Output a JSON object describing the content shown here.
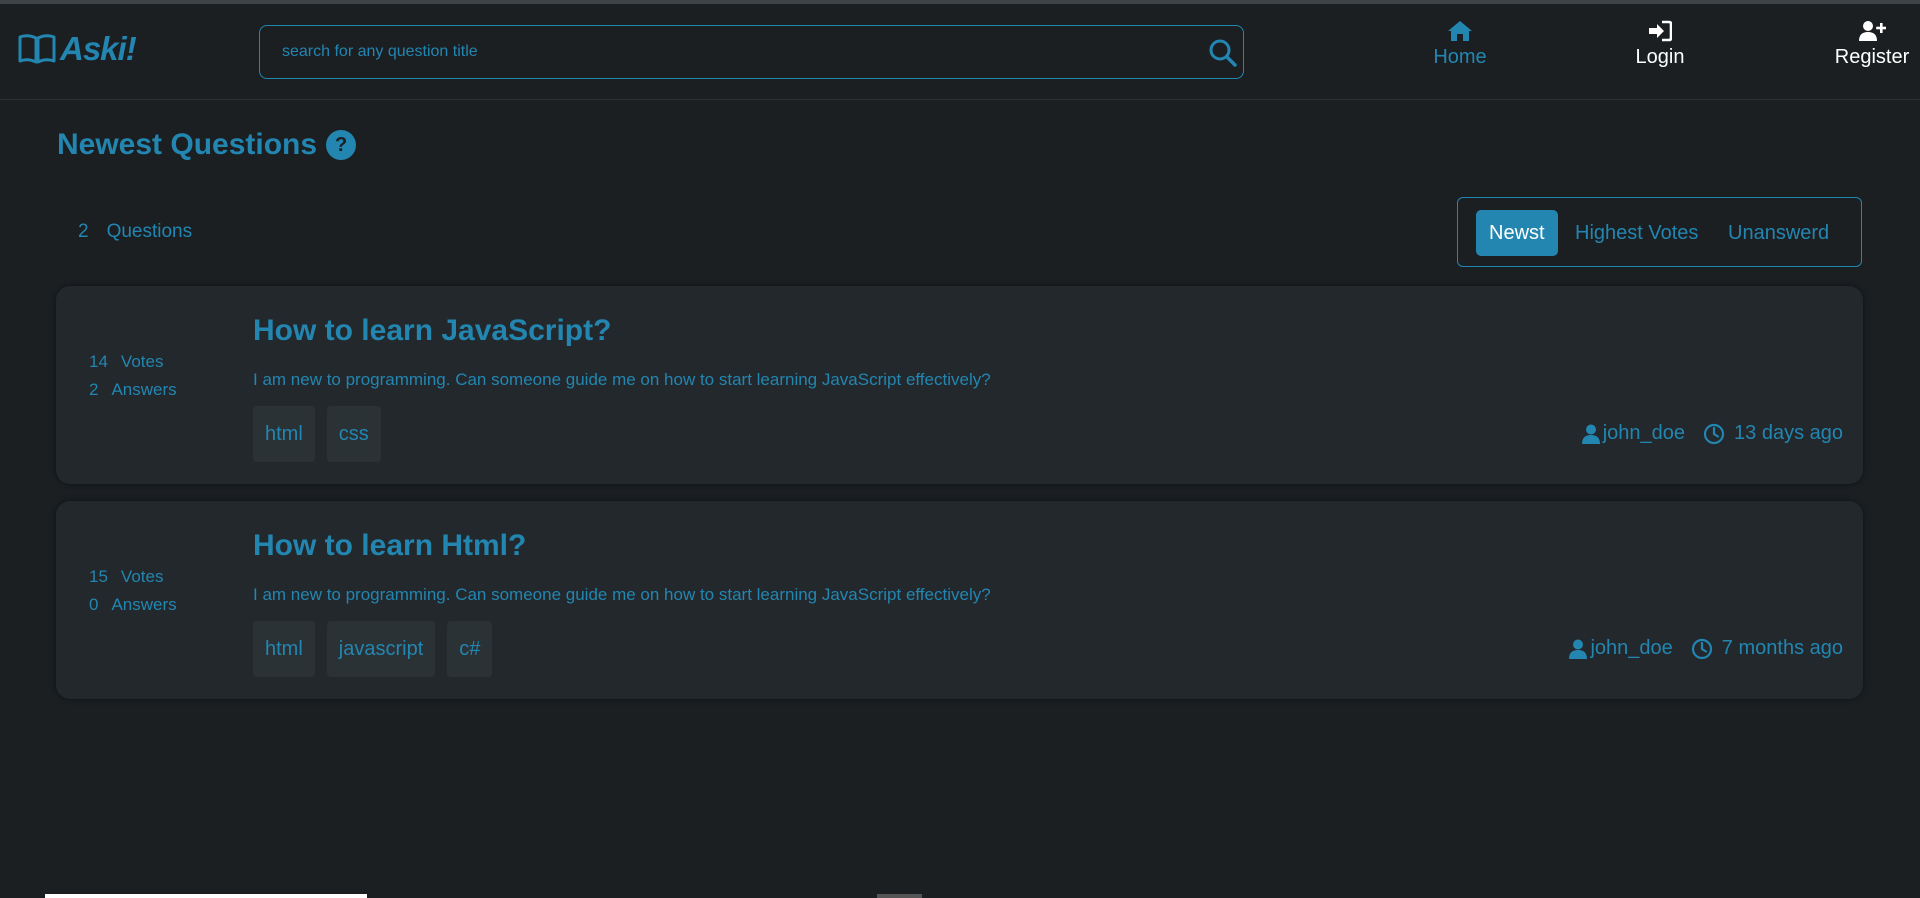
{
  "header": {
    "logo_text": "Aski!",
    "search_placeholder": "search for any question title",
    "nav": {
      "home": "Home",
      "login": "Login",
      "register": "Register"
    }
  },
  "page": {
    "title": "Newest Questions",
    "help_glyph": "?",
    "question_count": "2",
    "question_count_label": "Questions"
  },
  "sort": {
    "newest": "Newst",
    "highest_votes": "Highest Votes",
    "unanswered": "Unanswerd",
    "active": "newest"
  },
  "questions": [
    {
      "votes": "14",
      "votes_label": "Votes",
      "answers": "2",
      "answers_label": "Answers",
      "title": "How to learn JavaScript?",
      "body": "I am new to programming. Can someone guide me on how to start learning JavaScript effectively?",
      "tags": [
        "html",
        "css"
      ],
      "author": "john_doe",
      "time": "13 days ago"
    },
    {
      "votes": "15",
      "votes_label": "Votes",
      "answers": "0",
      "answers_label": "Answers",
      "title": "How to learn Html?",
      "body": "I am new to programming. Can someone guide me on how to start learning JavaScript effectively?",
      "tags": [
        "html",
        "javascript",
        "c#"
      ],
      "author": "john_doe",
      "time": "7 months ago"
    }
  ],
  "colors": {
    "accent": "#2386b1",
    "background": "#1b1f22",
    "card": "#22282c"
  },
  "icons": [
    "book-icon",
    "search-icon",
    "home-icon",
    "login-icon",
    "user-plus-icon",
    "question-circle-icon",
    "user-icon",
    "clock-icon"
  ]
}
